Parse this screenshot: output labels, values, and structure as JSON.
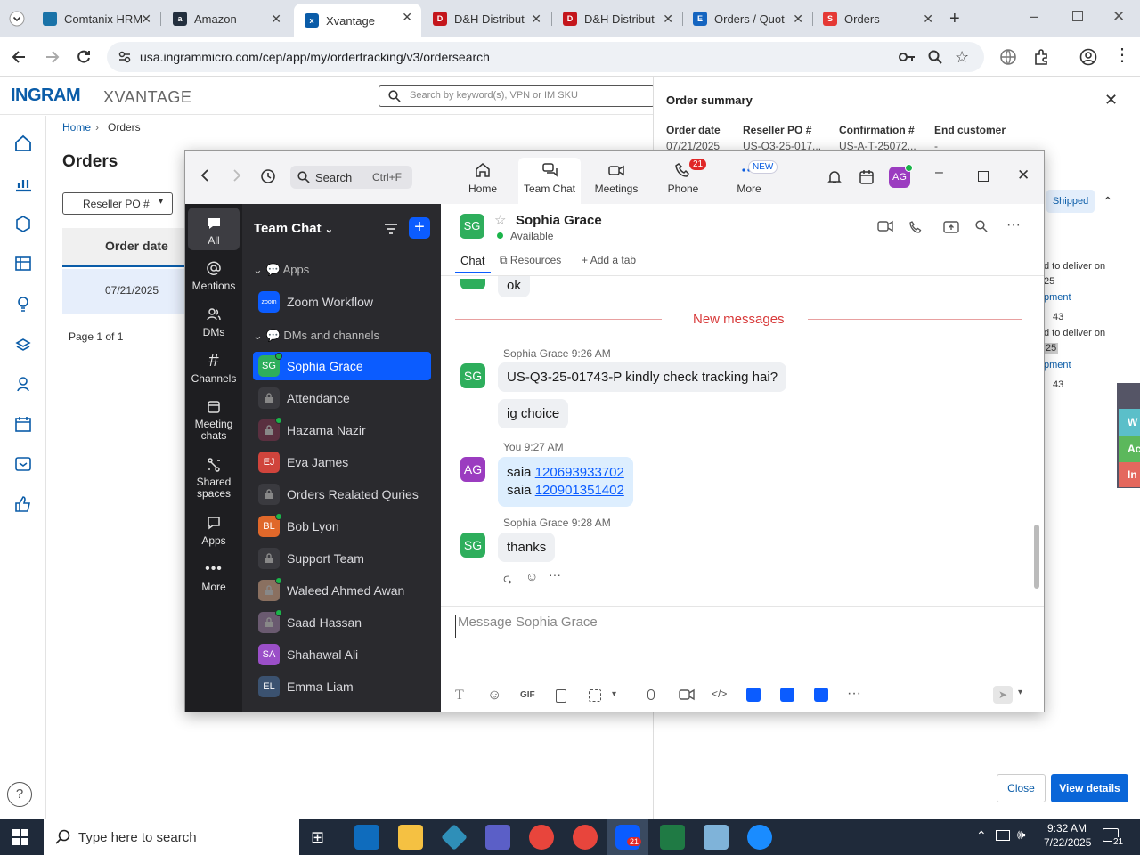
{
  "browser": {
    "tabs": [
      {
        "title": "Comtanix HRM",
        "color": "#1a73a8"
      },
      {
        "title": "Amazon",
        "color": "#232f3e"
      },
      {
        "title": "Xvantage",
        "color": "#0a5ca8"
      },
      {
        "title": "D&H Distribut",
        "color": "#c4161c"
      },
      {
        "title": "D&H Distribut",
        "color": "#c4161c"
      },
      {
        "title": "Orders / Quot",
        "color": "#1565c0"
      },
      {
        "title": "Orders",
        "color": "#e53935"
      }
    ],
    "url": "usa.ingrammicro.com/cep/app/my/ordertracking/v3/ordersearch"
  },
  "ingram": {
    "logo_a": "INGRAM",
    "logo_b": "XVANTAGE",
    "search_placeholder": "Search by keyword(s), VPN or IM SKU",
    "breadcrumb_home": "Home",
    "breadcrumb_sep": "›",
    "breadcrumb_current": "Orders",
    "page_title": "Orders",
    "filter_label": "Reseller PO #",
    "col_order_date": "Order date",
    "row_date": "07/21/2025",
    "pagination": "Page 1 of 1"
  },
  "summary": {
    "title": "Order summary",
    "headers": [
      "Order date",
      "Reseller PO #",
      "Confirmation #",
      "End customer"
    ],
    "values": [
      "07/21/2025",
      "US-Q3-25-017...",
      "US-A-T-25072...",
      "-"
    ],
    "status": "Shipped",
    "line1": "d to deliver on",
    "line1b": "25",
    "link1": "pment",
    "qty1": "43",
    "line2": "d to deliver on",
    "line2b": "25",
    "link2": "pment",
    "qty2": "43",
    "close_label": "Close",
    "details_label": "View details",
    "side_tabs": [
      "W",
      "Ac",
      "In"
    ]
  },
  "zoom": {
    "search_label": "Search",
    "search_shortcut": "Ctrl+F",
    "nav": [
      {
        "label": "Home"
      },
      {
        "label": "Team Chat"
      },
      {
        "label": "Meetings"
      },
      {
        "label": "Phone",
        "badge": "21"
      },
      {
        "label": "More",
        "badge": "NEW"
      }
    ],
    "user_initials": "AG",
    "rail": [
      {
        "label": "All"
      },
      {
        "label": "Mentions"
      },
      {
        "label": "DMs"
      },
      {
        "label": "Channels"
      },
      {
        "label": "Meeting chats"
      },
      {
        "label": "Shared spaces"
      },
      {
        "label": "Apps"
      },
      {
        "label": "More"
      }
    ],
    "list_title": "Team Chat",
    "section_apps": "Apps",
    "section_dms": "DMs and channels",
    "app_zoom": "Zoom Workflow",
    "zoom_logo": "zoom",
    "contacts": [
      {
        "name": "Sophia Grace",
        "initials": "SG",
        "color": "#2eae5c"
      },
      {
        "name": "Attendance",
        "initials": "",
        "color": "#3a3a3f"
      },
      {
        "name": "Hazama Nazir",
        "initials": "",
        "color": "#5a3040"
      },
      {
        "name": "Eva James",
        "initials": "EJ",
        "color": "#d0443c"
      },
      {
        "name": "Orders Realated Quries",
        "initials": "",
        "color": "#3a3a3f"
      },
      {
        "name": "Bob Lyon",
        "initials": "BL",
        "color": "#e0682a"
      },
      {
        "name": "Support Team",
        "initials": "",
        "color": "#3a3a3f"
      },
      {
        "name": "Waleed Ahmed Awan",
        "initials": "",
        "color": "#8a7060"
      },
      {
        "name": "Saad Hassan",
        "initials": "",
        "color": "#6a5a70"
      },
      {
        "name": "Shahawal Ali",
        "initials": "SA",
        "color": "#9b4fc8"
      },
      {
        "name": "Emma Liam",
        "initials": "EL",
        "color": "#3b5270"
      }
    ],
    "chat": {
      "name": "Sophia Grace",
      "initials": "SG",
      "status": "Available",
      "tab_chat": "Chat",
      "tab_resources": "Resources",
      "tab_add": "Add a tab",
      "prev_msg": "ok",
      "new_messages": "New messages",
      "sender1": "Sophia Grace",
      "time1": "9:26 AM",
      "msg1": "US-Q3-25-01743-P kindly check tracking hai?",
      "msg2": "ig choice",
      "sender2": "You",
      "time2": "9:27 AM",
      "msg3_prefix": "saia",
      "msg3_link": "120693933702",
      "msg4_prefix": "saia",
      "msg4_link": "120901351402",
      "sender3": "Sophia Grace",
      "time3": "9:28 AM",
      "msg5": "thanks",
      "composer_placeholder": "Message Sophia Grace",
      "gif": "GIF"
    }
  },
  "taskbar": {
    "search_placeholder": "Type here to search",
    "time": "9:32 AM",
    "date": "7/22/2025",
    "zoom_badge": "21",
    "notif_count": "21"
  }
}
